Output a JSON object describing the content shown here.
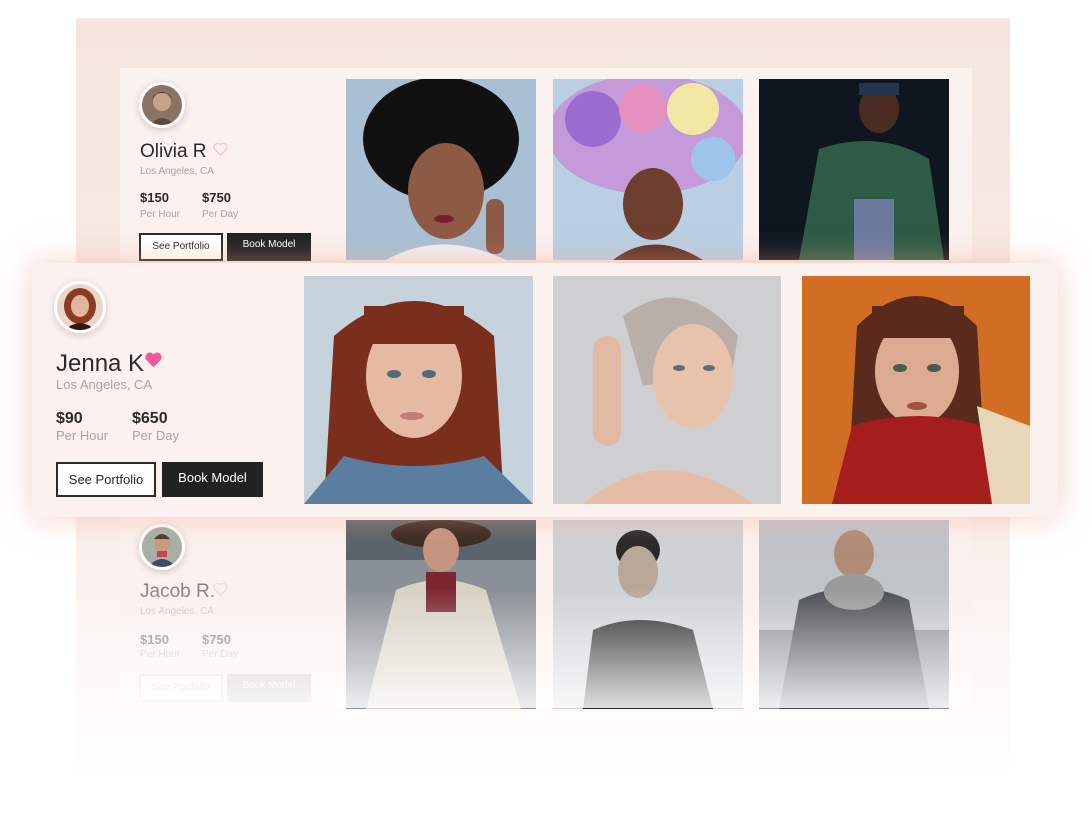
{
  "colors": {
    "accent": "#f05a9a",
    "dark": "#222222",
    "muted": "#a9a3a1",
    "card": "#fbf1ee"
  },
  "models": [
    {
      "name": "Olivia R",
      "location": "Los Angeles, CA",
      "price_hour": "$150",
      "price_hour_label": "Per Hour",
      "price_day": "$750",
      "price_day_label": "Per Day",
      "see_portfolio": "See Portfolio",
      "book_model": "Book Model",
      "favorited": false,
      "heart_icon": "heart-outline-icon"
    },
    {
      "name": "Jenna K",
      "location": "Los Angeles, CA",
      "price_hour": "$90",
      "price_hour_label": "Per Hour",
      "price_day": "$650",
      "price_day_label": "Per Day",
      "see_portfolio": "See Portfolio",
      "book_model": "Book Model",
      "favorited": true,
      "heart_icon": "heart-filled-icon"
    },
    {
      "name": "Jacob R.",
      "location": "Los Angeles, CA",
      "price_hour": "$150",
      "price_hour_label": "Per Hour",
      "price_day": "$750",
      "price_day_label": "Per Day",
      "see_portfolio": "See Portfolio",
      "book_model": "Book Model",
      "favorited": false,
      "heart_icon": "heart-outline-icon"
    }
  ]
}
